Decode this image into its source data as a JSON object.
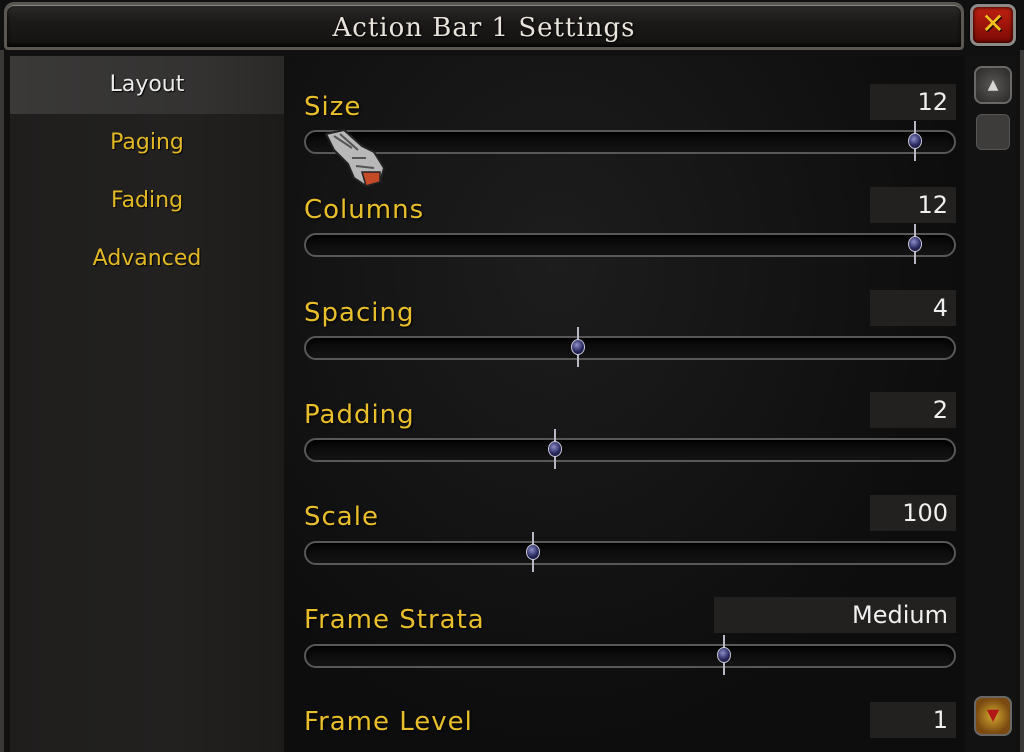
{
  "window": {
    "title": "Action Bar 1 Settings",
    "close_label": "✕"
  },
  "sidebar": {
    "items": [
      {
        "label": "Layout",
        "selected": true
      },
      {
        "label": "Paging",
        "selected": false
      },
      {
        "label": "Fading",
        "selected": false
      },
      {
        "label": "Advanced",
        "selected": false
      }
    ]
  },
  "settings": {
    "size": {
      "label": "Size",
      "value": "12",
      "fraction": 0.94
    },
    "columns": {
      "label": "Columns",
      "value": "12",
      "fraction": 0.94
    },
    "spacing": {
      "label": "Spacing",
      "value": "4",
      "fraction": 0.42
    },
    "padding": {
      "label": "Padding",
      "value": "2",
      "fraction": 0.385
    },
    "scale": {
      "label": "Scale",
      "value": "100",
      "fraction": 0.35
    },
    "frame_strata": {
      "label": "Frame Strata",
      "value": "Medium",
      "fraction": 0.645
    },
    "frame_level": {
      "label": "Frame Level",
      "value": "1"
    }
  },
  "scrollbar": {
    "up_icon": "scroll-up-arrow",
    "down_icon": "scroll-down-arrow"
  },
  "colors": {
    "label_gold": "#e8bf2a",
    "selected_nav_text": "#ececec",
    "close_red": "#c02010"
  }
}
